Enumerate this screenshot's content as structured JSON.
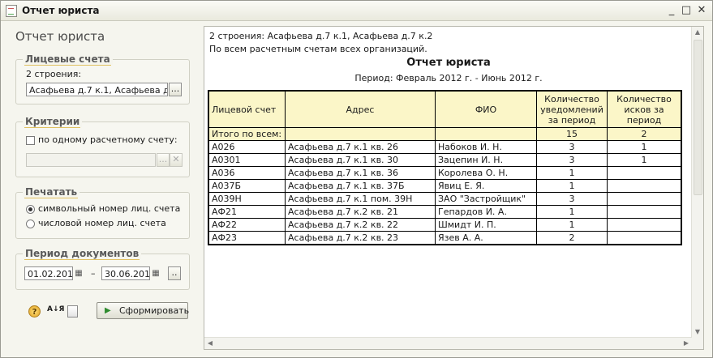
{
  "window": {
    "title": "Отчет юриста",
    "min": "_",
    "max": "□",
    "close": "✕"
  },
  "left": {
    "page_title": "Отчет юриста",
    "accounts": {
      "legend": "Лицевые счета",
      "sub": "2 строения:",
      "value": "Асафьева д.7 к.1, Асафьева д.7 к",
      "btn": "..."
    },
    "criteria": {
      "legend": "Критерии",
      "checkbox_label": "по одному расчетному счету:",
      "btn": "...",
      "clear": "✕"
    },
    "print": {
      "legend": "Печатать",
      "options": [
        "символьный номер лиц. счета",
        "числовой номер лиц. счета"
      ],
      "selected": 0
    },
    "period": {
      "legend": "Период документов",
      "from": "01.02.2012",
      "dash": "–",
      "to": "30.06.2012",
      "btn": ".."
    },
    "footer": {
      "help": "?",
      "sort": "А↓Я",
      "generate": "Сформировать"
    }
  },
  "report": {
    "line1": "2 строения: Асафьева д.7 к.1, Асафьева д.7 к.2",
    "line2": "По всем расчетным счетам всех организаций.",
    "title": "Отчет юриста",
    "period": "Период: Февраль 2012 г. - Июнь 2012 г.",
    "headers": [
      "Лицевой счет",
      "Адрес",
      "ФИО",
      "Количество уведомлений за период",
      "Количество исков за период"
    ],
    "total": {
      "label": "Итого по всем:",
      "notices": "15",
      "suits": "2"
    },
    "rows": [
      {
        "acc": "А026",
        "addr": "Асафьева д.7 к.1 кв. 26",
        "fio": "Набоков И. Н.",
        "n": "3",
        "s": "1"
      },
      {
        "acc": "А0301",
        "addr": "Асафьева д.7 к.1 кв. 30",
        "fio": "Зацепин И. Н.",
        "n": "3",
        "s": "1"
      },
      {
        "acc": "А036",
        "addr": "Асафьева д.7 к.1 кв. 36",
        "fio": "Королева О. Н.",
        "n": "1",
        "s": ""
      },
      {
        "acc": "А037Б",
        "addr": "Асафьева д.7 к.1 кв. 37Б",
        "fio": "Явиц Е. Я.",
        "n": "1",
        "s": ""
      },
      {
        "acc": "А039Н",
        "addr": "Асафьева д.7 к.1 пом. 39Н",
        "fio": "ЗАО \"Застройщик\"",
        "n": "3",
        "s": ""
      },
      {
        "acc": "АФ21",
        "addr": "Асафьева д.7 к.2 кв. 21",
        "fio": "Гепардов И. А.",
        "n": "1",
        "s": ""
      },
      {
        "acc": "АФ22",
        "addr": "Асафьева д.7 к.2 кв. 22",
        "fio": "Шмидт И. П.",
        "n": "1",
        "s": ""
      },
      {
        "acc": "АФ23",
        "addr": "Асафьева д.7 к.2 кв. 23",
        "fio": "Язев А. А.",
        "n": "2",
        "s": ""
      }
    ]
  }
}
